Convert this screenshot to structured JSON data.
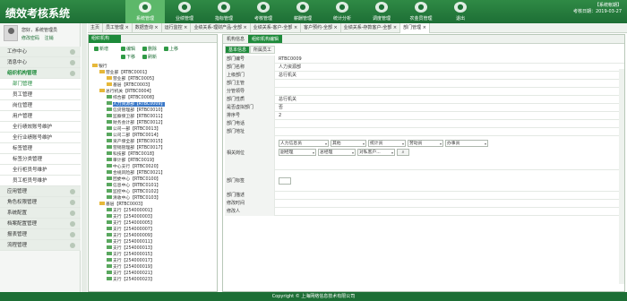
{
  "app": {
    "title": "绩效考核系统"
  },
  "nav": [
    {
      "label": "系统管理",
      "icon": "gear-icon",
      "active": true
    },
    {
      "label": "业绩管理",
      "icon": "chart-icon"
    },
    {
      "label": "指标管理",
      "icon": "target-icon"
    },
    {
      "label": "考核管理",
      "icon": "clipboard-icon"
    },
    {
      "label": "薪酬管理",
      "icon": "money-icon"
    },
    {
      "label": "统计分析",
      "icon": "analysis-icon"
    },
    {
      "label": "调度管理",
      "icon": "schedule-icon"
    },
    {
      "label": "农金员管理",
      "icon": "people-icon"
    },
    {
      "label": "退出",
      "icon": "power-icon"
    }
  ],
  "sysinfo": {
    "line1": "【系统帐期】",
    "line2": "考核日期：2019-03-27"
  },
  "user": {
    "name": "您好，系统管理员",
    "link1": "修改密码",
    "link2": "注销"
  },
  "menu": [
    {
      "label": "工作中心",
      "type": "group"
    },
    {
      "label": "消息中心",
      "type": "group"
    },
    {
      "label": "组织机构管理",
      "type": "group",
      "active": true
    },
    {
      "label": "部门管理",
      "type": "sub",
      "selected": true
    },
    {
      "label": "员工管理",
      "type": "sub"
    },
    {
      "label": "岗位管理",
      "type": "sub"
    },
    {
      "label": "用户管理",
      "type": "sub"
    },
    {
      "label": "全行绩效账号维护",
      "type": "sub"
    },
    {
      "label": "全行业绩账号维护",
      "type": "sub"
    },
    {
      "label": "标签管理",
      "type": "sub"
    },
    {
      "label": "标签分类管理",
      "type": "sub"
    },
    {
      "label": "全行柜员号维护",
      "type": "sub"
    },
    {
      "label": "员工柜员号维护",
      "type": "sub"
    },
    {
      "label": "应用管理",
      "type": "group"
    },
    {
      "label": "角色权限管理",
      "type": "group"
    },
    {
      "label": "系统配置",
      "type": "group"
    },
    {
      "label": "档案配置管理",
      "type": "group"
    },
    {
      "label": "报表管理",
      "type": "group"
    },
    {
      "label": "流程管理",
      "type": "group"
    }
  ],
  "tabs": [
    {
      "label": "主页"
    },
    {
      "label": "员工管理 ×"
    },
    {
      "label": "数据查询 ×"
    },
    {
      "label": "运行监控 ×"
    },
    {
      "label": "业绩关系-理财产品-全部 ×"
    },
    {
      "label": "业绩关系-客户-全部 ×"
    },
    {
      "label": "客户预约-全部 ×"
    },
    {
      "label": "业绩关系-存款客户-全部 ×"
    },
    {
      "label": "部门管理 ×",
      "active": true
    }
  ],
  "left": {
    "title": "组织机构",
    "buttons": {
      "add": "新增",
      "edit": "编辑",
      "delete": "删除",
      "up": "上移",
      "down": "下移",
      "refresh": "刷新"
    }
  },
  "tree": [
    {
      "label": "银行",
      "indent": 0,
      "type": "folder"
    },
    {
      "label": "营业部【RTBC0001】",
      "indent": 1,
      "type": "folder"
    },
    {
      "label": "营业部【RTBC0005】",
      "indent": 2,
      "type": "folder"
    },
    {
      "label": "基层【RTBC0003】",
      "indent": 2,
      "type": "folder"
    },
    {
      "label": "总行机关【RTBC0004】",
      "indent": 1,
      "type": "folder"
    },
    {
      "label": "综合部【RTBC0008】",
      "indent": 2,
      "type": "doc"
    },
    {
      "label": "人力资源部【RTBC0009】",
      "indent": 2,
      "type": "doc",
      "selected": true
    },
    {
      "label": "信贷管理部【RTBC0010】",
      "indent": 2,
      "type": "doc"
    },
    {
      "label": "监察保卫部【RTBC0011】",
      "indent": 2,
      "type": "doc"
    },
    {
      "label": "财务会计部【RTBC0012】",
      "indent": 2,
      "type": "doc"
    },
    {
      "label": "公司一部【RTBC0013】",
      "indent": 2,
      "type": "doc"
    },
    {
      "label": "公司二部【RTBC0014】",
      "indent": 2,
      "type": "doc"
    },
    {
      "label": "资产保全部【RTBC0015】",
      "indent": 2,
      "type": "doc"
    },
    {
      "label": "营销管理部【RTBC0017】",
      "indent": 2,
      "type": "doc"
    },
    {
      "label": "科技部【RTBC0018】",
      "indent": 2,
      "type": "doc"
    },
    {
      "label": "审计部【RTBC0019】",
      "indent": 2,
      "type": "doc"
    },
    {
      "label": "中心支行【RTBC0020】",
      "indent": 2,
      "type": "doc"
    },
    {
      "label": "合规风险部【RTBC0021】",
      "indent": 2,
      "type": "doc"
    },
    {
      "label": "团委中心【RTBC0100】",
      "indent": 2,
      "type": "doc"
    },
    {
      "label": "信息中心【RTBC0101】",
      "indent": 2,
      "type": "doc"
    },
    {
      "label": "监控中心【RTBC0102】",
      "indent": 2,
      "type": "doc"
    },
    {
      "label": "清收中心【RTBC0103】",
      "indent": 2,
      "type": "doc"
    },
    {
      "label": "基层【RTBC0003】",
      "indent": 1,
      "type": "folder"
    },
    {
      "label": "支行【254000001】",
      "indent": 2,
      "type": "doc"
    },
    {
      "label": "支行【254000003】",
      "indent": 2,
      "type": "doc"
    },
    {
      "label": "支行【254000005】",
      "indent": 2,
      "type": "doc"
    },
    {
      "label": "支行【254000007】",
      "indent": 2,
      "type": "doc"
    },
    {
      "label": "支行【254000009】",
      "indent": 2,
      "type": "doc"
    },
    {
      "label": "支行【254000011】",
      "indent": 2,
      "type": "doc"
    },
    {
      "label": "支行【254000013】",
      "indent": 2,
      "type": "doc"
    },
    {
      "label": "支行【254000015】",
      "indent": 2,
      "type": "doc"
    },
    {
      "label": "支行【254000017】",
      "indent": 2,
      "type": "doc"
    },
    {
      "label": "支行【254000019】",
      "indent": 2,
      "type": "doc"
    },
    {
      "label": "支行【254000021】",
      "indent": 2,
      "type": "doc"
    },
    {
      "label": "支行【254000023】",
      "indent": 2,
      "type": "doc"
    }
  ],
  "right": {
    "tabs": [
      {
        "label": "机构信息"
      },
      {
        "label": "组织机构编辑",
        "active": true
      }
    ],
    "subtabs": [
      {
        "label": "基本信息",
        "active": true
      },
      {
        "label": "所属员工"
      }
    ]
  },
  "form": {
    "rows": [
      {
        "label": "部门编号",
        "value": "RTBC0009"
      },
      {
        "label": "部门名称",
        "value": "人力资源部"
      },
      {
        "label": "上级部门",
        "value": "总行机关"
      },
      {
        "label": "部门主管",
        "value": ""
      },
      {
        "label": "分管领导",
        "value": ""
      },
      {
        "label": "部门性质",
        "value": "总行机关"
      },
      {
        "label": "是否虚拟部门",
        "value": "否"
      },
      {
        "label": "排序号",
        "value": "2"
      },
      {
        "label": "部门电话",
        "value": ""
      },
      {
        "label": "部门地址",
        "value": ""
      }
    ],
    "posts_label": "相关岗位",
    "posts_row1": [
      "人力信息员",
      "其他",
      "统计员",
      "劳动员",
      "办事员"
    ],
    "posts_row2": [
      "副经理",
      "总经理",
      "对私客户..."
    ],
    "tag_label": "部门标签",
    "desc_label": "部门描述",
    "time_label": "修改时间",
    "modifier_label": "修改人"
  },
  "footer": {
    "text": "Copyright © 上海网络信息技术有限公司"
  }
}
